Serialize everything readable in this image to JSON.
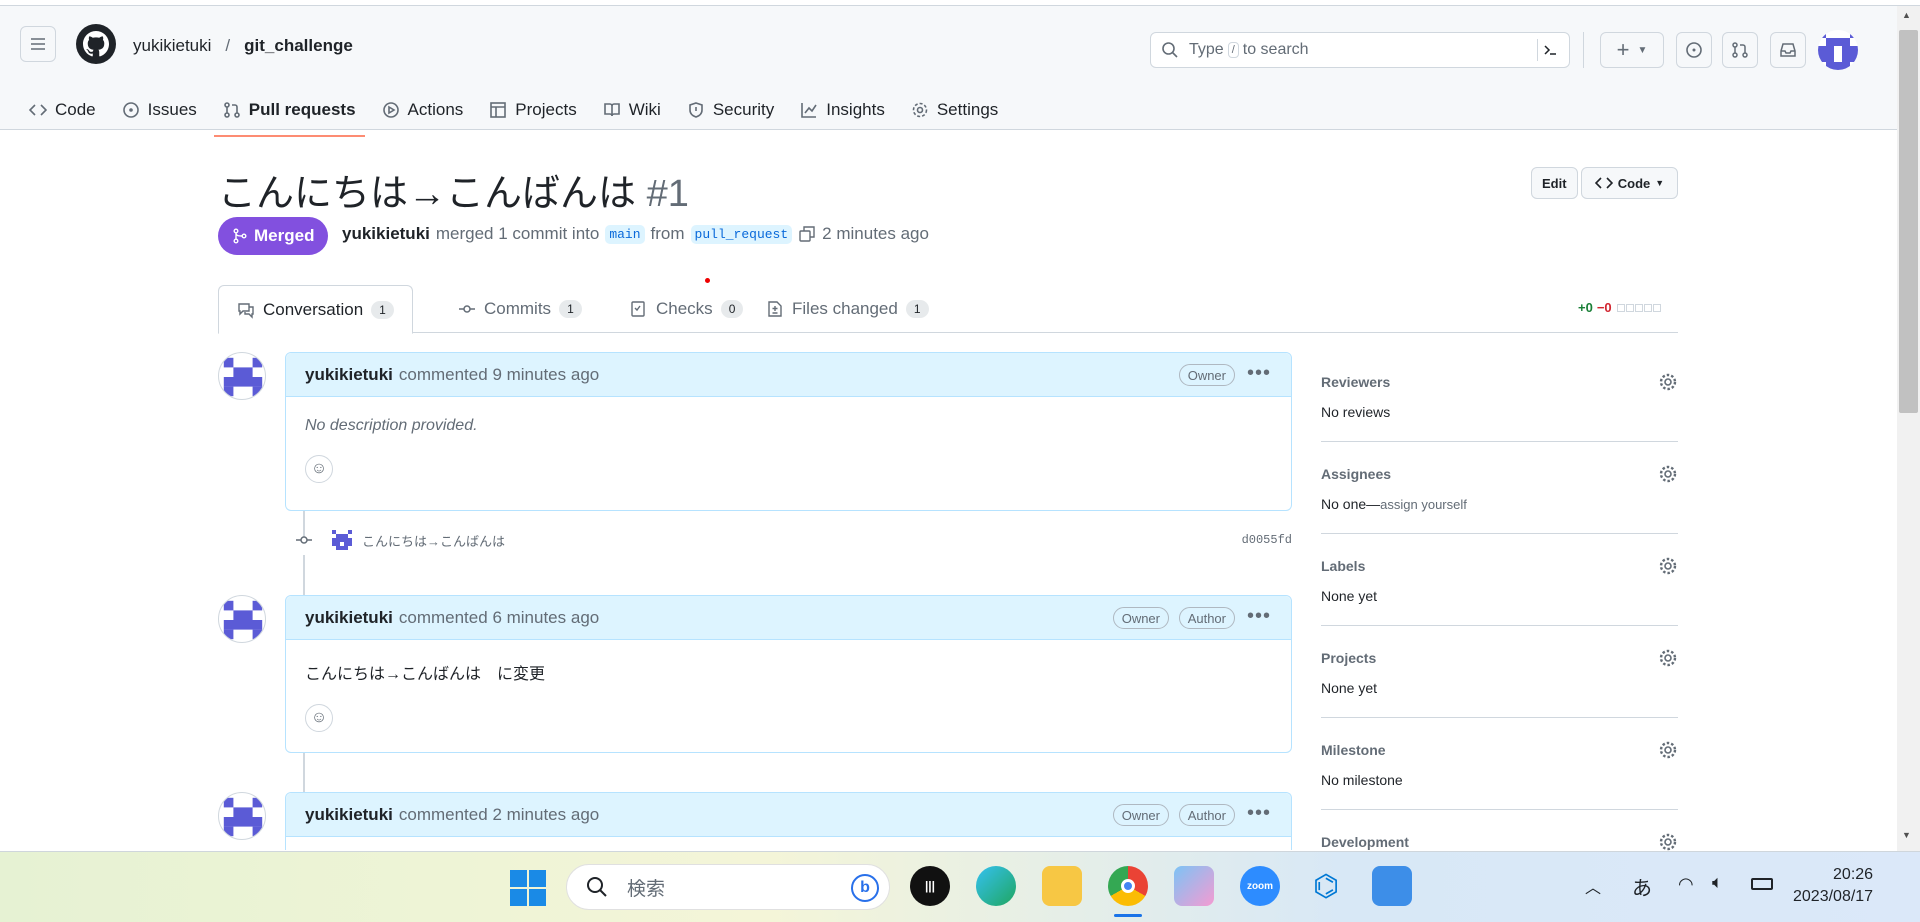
{
  "header": {
    "owner": "yukikietuki",
    "separator": "/",
    "repo": "git_challenge",
    "search_placeholder_a": "Type",
    "search_key": "/",
    "search_placeholder_b": "to search"
  },
  "nav": [
    {
      "label": "Code"
    },
    {
      "label": "Issues"
    },
    {
      "label": "Pull requests"
    },
    {
      "label": "Actions"
    },
    {
      "label": "Projects"
    },
    {
      "label": "Wiki"
    },
    {
      "label": "Security"
    },
    {
      "label": "Insights"
    },
    {
      "label": "Settings"
    }
  ],
  "pr": {
    "title": "こんにちは→こんばんは",
    "number": "#1",
    "edit_label": "Edit",
    "code_label": "Code",
    "state": "Merged",
    "author": "yukikietuki",
    "merge_text": "merged 1 commit into",
    "base": "main",
    "from": "from",
    "head": "pull_request",
    "time": "2 minutes ago"
  },
  "tabs": [
    {
      "label": "Conversation",
      "count": "1"
    },
    {
      "label": "Commits",
      "count": "1"
    },
    {
      "label": "Checks",
      "count": "0"
    },
    {
      "label": "Files changed",
      "count": "1"
    }
  ],
  "diffstat": {
    "add": "+0",
    "del": "−0"
  },
  "comments": [
    {
      "author": "yukikietuki",
      "action": "commented",
      "time": "9 minutes ago",
      "badges": [
        "Owner"
      ],
      "body": "No description provided."
    },
    {
      "author": "yukikietuki",
      "action": "commented",
      "time": "6 minutes ago",
      "badges": [
        "Owner",
        "Author"
      ],
      "body": "こんにちは→こんばんは　に変更"
    },
    {
      "author": "yukikietuki",
      "action": "commented",
      "time": "2 minutes ago",
      "badges": [
        "Owner",
        "Author"
      ],
      "body": ""
    }
  ],
  "commit": {
    "message": "こんにちは→こんばんは",
    "sha": "d0055fd"
  },
  "sidebar": [
    {
      "heading": "Reviewers",
      "value": "No reviews"
    },
    {
      "heading": "Assignees",
      "value": "No one—",
      "link": "assign yourself"
    },
    {
      "heading": "Labels",
      "value": "None yet"
    },
    {
      "heading": "Projects",
      "value": "None yet"
    },
    {
      "heading": "Milestone",
      "value": "No milestone"
    },
    {
      "heading": "Development",
      "value": ""
    }
  ],
  "taskbar": {
    "search": "検索",
    "time": "20:26",
    "date": "2023/08/17",
    "ime": "あ"
  },
  "colors": {
    "merged": "#8250df",
    "accent": "#fd8c73",
    "link": "#0969da"
  }
}
